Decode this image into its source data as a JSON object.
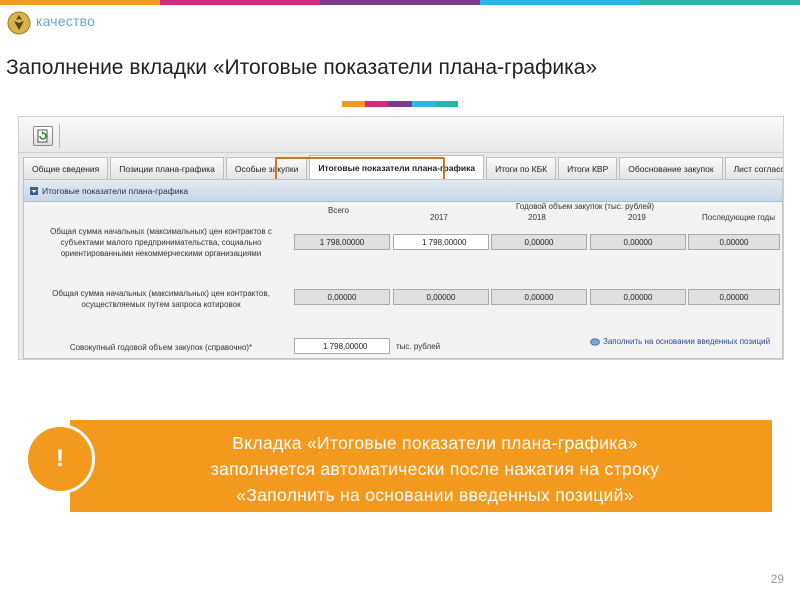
{
  "colors": {
    "strip": [
      "#f39a1e",
      "#d6297b",
      "#7a3c8e",
      "#29b7e8",
      "#2ab3a6"
    ],
    "callout": "#f39a1e",
    "oval": "#c41a1a",
    "tab_highlight": "#c57a2a"
  },
  "brand": {
    "text": "качество",
    "logo_icon": "emblem-icon"
  },
  "slide": {
    "title": "Заполнение вкладки «Итоговые показатели плана-графика»",
    "page_number": "29"
  },
  "screenshot": {
    "toolbar": {
      "button_icon": "refresh-document-icon"
    },
    "tabs": [
      {
        "label": "Общие сведения",
        "active": false
      },
      {
        "label": "Позиции плана-графика",
        "active": false
      },
      {
        "label": "Особые закупки",
        "active": false
      },
      {
        "label": "Итоговые показатели плана-графика",
        "active": true
      },
      {
        "label": "Итоги по КБК",
        "active": false
      },
      {
        "label": "Итоги КВР",
        "active": false
      },
      {
        "label": "Обоснование закупок",
        "active": false
      },
      {
        "label": "Лист согласования",
        "active": false
      }
    ],
    "panel": {
      "header": "Итоговые показатели плана-графика",
      "total_label": "Всего",
      "annual_label": "Годовой объем закупок (тыс. рублей)",
      "years": [
        "2017",
        "2018",
        "2019",
        "Последующие годы"
      ],
      "rows": [
        {
          "label": "Общая сумма начальных (максимальных) цен контрактов с субъектами малого предпринимательства, социально ориентированными некоммерческими организациями",
          "values": [
            "1 798,00000",
            "1 798,00000",
            "0,00000",
            "0,00000",
            "0,00000"
          ]
        },
        {
          "label": "Общая сумма начальных (максимальных) цен контрактов, осуществляемых путем запроса котировок",
          "values": [
            "0,00000",
            "0,00000",
            "0,00000",
            "0,00000",
            "0,00000"
          ]
        }
      ],
      "aggregate": {
        "label": "Совокупный годовой объем закупок (справочно)*",
        "value": "1 798,00000",
        "units": "тыс. рублей"
      },
      "fill_link": "Заполнить на основании введенных позиций"
    }
  },
  "callout": {
    "badge": "!",
    "line1": "Вкладка «Итоговые показатели плана-графика»",
    "line2": "заполняется автоматически после нажатия на строку",
    "line3": "«Заполнить на основании введенных позиций»"
  }
}
